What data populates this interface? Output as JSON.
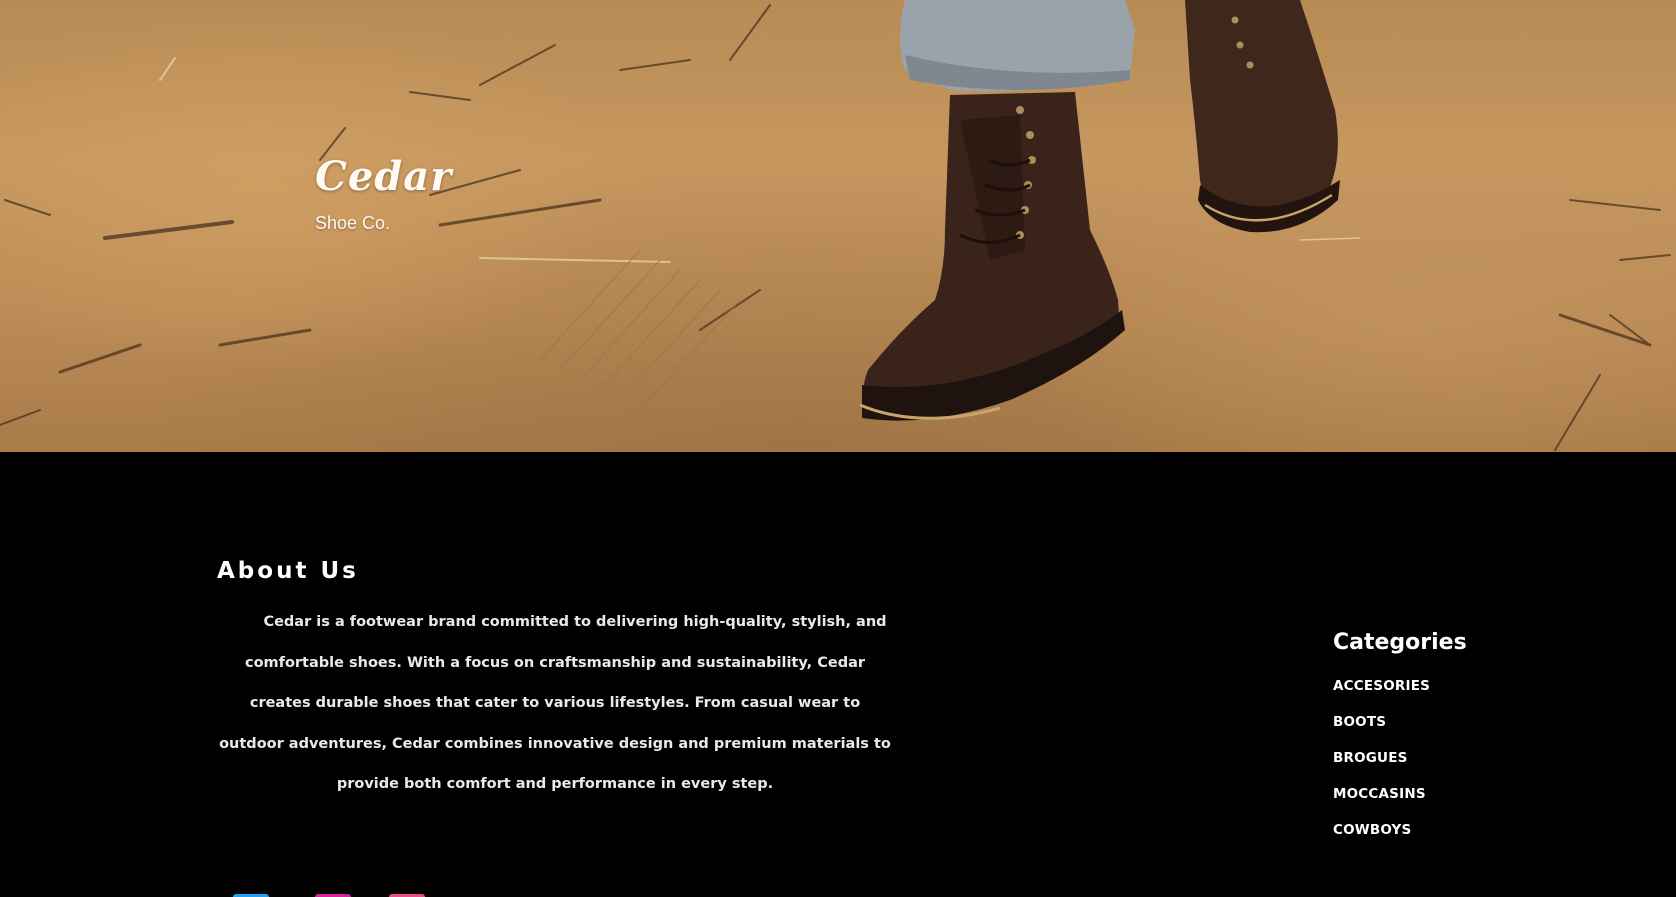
{
  "hero": {
    "brand_name": "Cedar",
    "tagline": "Shoe Co."
  },
  "about": {
    "title": "About Us",
    "text": "Cedar is a footwear brand committed to delivering high-quality, stylish, and comfortable shoes. With a focus on craftsmanship and sustainability, Cedar creates durable shoes that cater to various lifestyles. From casual wear to outdoor adventures, Cedar combines innovative design and premium materials to provide both comfort and performance in every step."
  },
  "categories": {
    "title": "Categories",
    "items": [
      {
        "label": "ACCESORIES"
      },
      {
        "label": "BOOTS"
      },
      {
        "label": "BROGUES"
      },
      {
        "label": "MOCCASINS"
      },
      {
        "label": "COWBOYS"
      }
    ]
  },
  "social": {
    "icons": [
      {
        "name": "facebook-icon",
        "color": "#1da1f2"
      },
      {
        "name": "instagram-icon",
        "color": "#d6249f"
      },
      {
        "name": "dribbble-icon",
        "color": "#ea4c89"
      }
    ]
  },
  "colors": {
    "footer_bg": "#000000",
    "hero_sand": "#c6975f",
    "text": "#ffffff"
  }
}
